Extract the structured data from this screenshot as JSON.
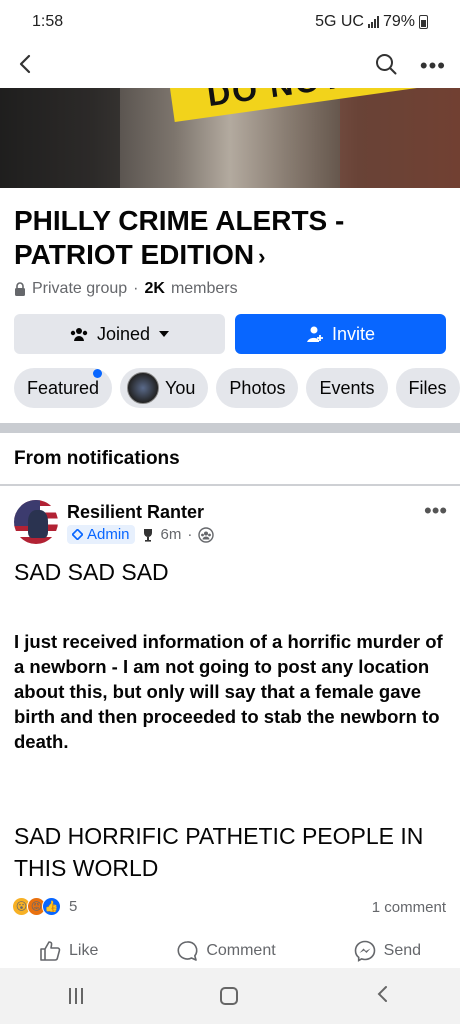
{
  "status_bar": {
    "time": "1:58",
    "network": "5G UC",
    "battery": "79%"
  },
  "nav": {
    "back_icon": "chevron-left-icon",
    "search_icon": "search-icon",
    "more_icon": "more-dots-icon"
  },
  "cover": {
    "tape_text": "DO NOT"
  },
  "group": {
    "title": "PHILLY CRIME ALERTS - PATRIOT EDITION",
    "privacy": "Private group",
    "members_count": "2K",
    "members_label": "members",
    "joined_label": "Joined",
    "invite_label": "Invite"
  },
  "tabs": [
    {
      "label": "Featured"
    },
    {
      "label": "You"
    },
    {
      "label": "Photos"
    },
    {
      "label": "Events"
    },
    {
      "label": "Files"
    }
  ],
  "section": {
    "title": "From notifications"
  },
  "post": {
    "author": "Resilient Ranter",
    "role": "Admin",
    "time": "6m",
    "heading1": "SAD SAD SAD",
    "body": "I just received information of a horrific murder of a newborn - I am not going to post any location about this, but only will say that a female gave birth and then proceeded to stab the newborn to death.",
    "heading2": "SAD HORRIFIC PATHETIC PEOPLE IN THIS WORLD",
    "reaction_count": "5",
    "comments": "1 comment"
  },
  "actions": {
    "like": "Like",
    "comment": "Comment",
    "send": "Send"
  },
  "colors": {
    "accent": "#0866ff",
    "secondary_text": "#65676b",
    "button_gray": "#e4e6eb"
  }
}
